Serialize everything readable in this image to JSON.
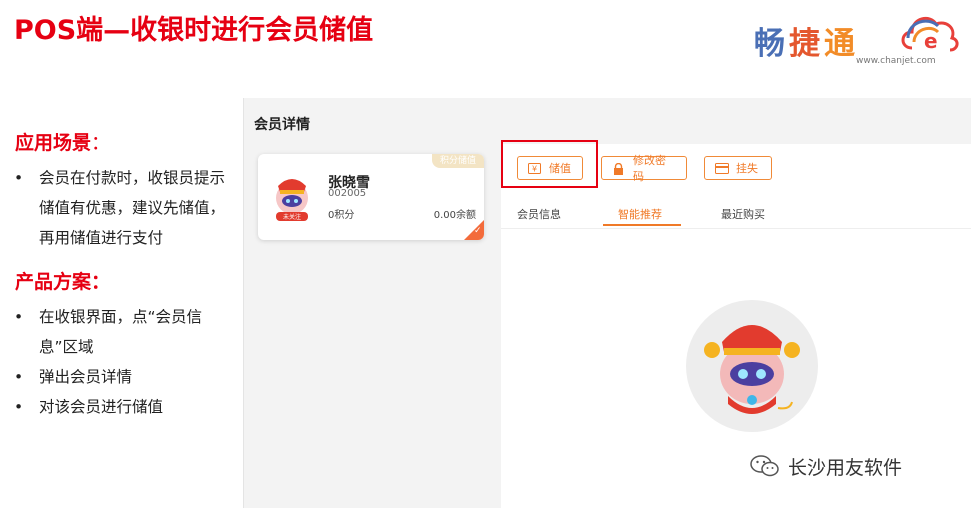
{
  "slide": {
    "title": "POS端—收银时进行会员储值"
  },
  "logo": {
    "brand_part1": "畅",
    "brand_part2": "捷",
    "brand_part3": "通",
    "url": "www.chanjet.com",
    "cloud_icon": "cloud-e-icon"
  },
  "left": {
    "scene_title": "应用场景",
    "scene_colon": "：",
    "scene_items": [
      "会员在付款时，收银员提示储值有优惠，建议先储值，再用储值进行支付"
    ],
    "plan_title": "产品方案：",
    "plan_items": [
      "在收银界面，点“会员信息”区域",
      "弹出会员详情",
      "对该会员进行储值"
    ]
  },
  "app": {
    "title": "会员详情",
    "member": {
      "name": "张晓雪",
      "code": "002005",
      "points": "0积分",
      "balance": "0.00余额",
      "corner_badge": "积分储值",
      "avatar_tag": "未关注",
      "avatar_icon": "pig-mascot-icon"
    },
    "buttons": {
      "store": "储值",
      "change_password": "修改密码",
      "report_loss": "挂失"
    },
    "tabs": [
      "会员信息",
      "智能推荐",
      "最近购买"
    ],
    "active_tab": "智能推荐",
    "empty_state_icon": "pig-mascot-icon"
  },
  "watermark": {
    "text": "长沙用友软件",
    "icon": "wechat-icon"
  },
  "colors": {
    "accent_red": "#e60012",
    "accent_orange": "#f07a28"
  }
}
